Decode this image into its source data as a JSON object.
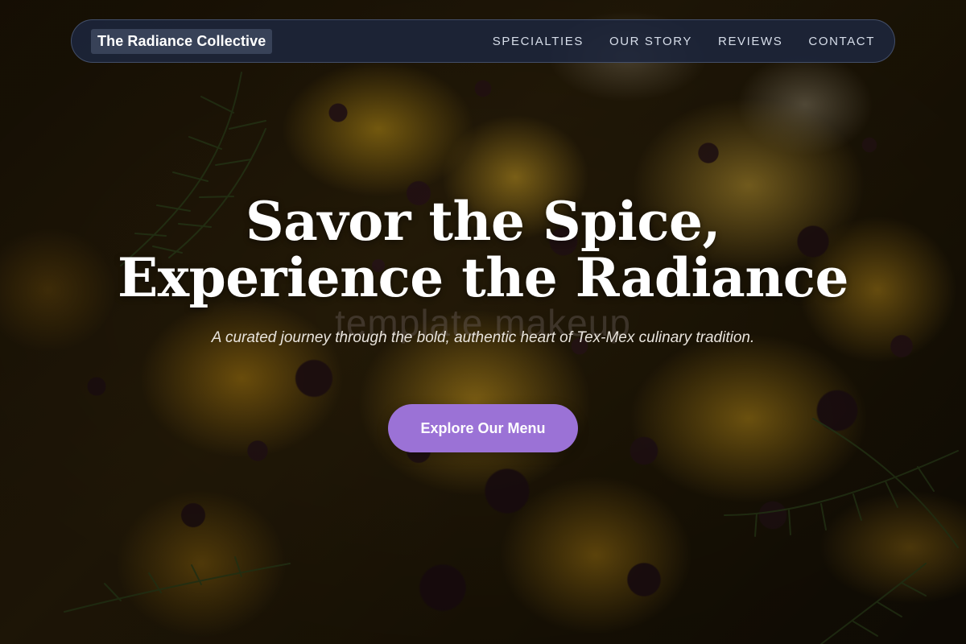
{
  "nav": {
    "brand": "The Radiance Collective",
    "links": [
      {
        "label": "SPECIALTIES"
      },
      {
        "label": "OUR STORY"
      },
      {
        "label": "REVIEWS"
      },
      {
        "label": "CONTACT"
      }
    ]
  },
  "hero": {
    "headline_line1": "Savor the Spice,",
    "headline_line2": "Experience the Radiance",
    "watermark": "template makeup",
    "subtitle": "A curated journey through the bold, authentic heart of Tex-Mex culinary tradition.",
    "cta_label": "Explore Our Menu"
  },
  "colors": {
    "accent": "#9b72d6",
    "nav_background": "#1c263c",
    "text_primary": "#ffffff"
  }
}
